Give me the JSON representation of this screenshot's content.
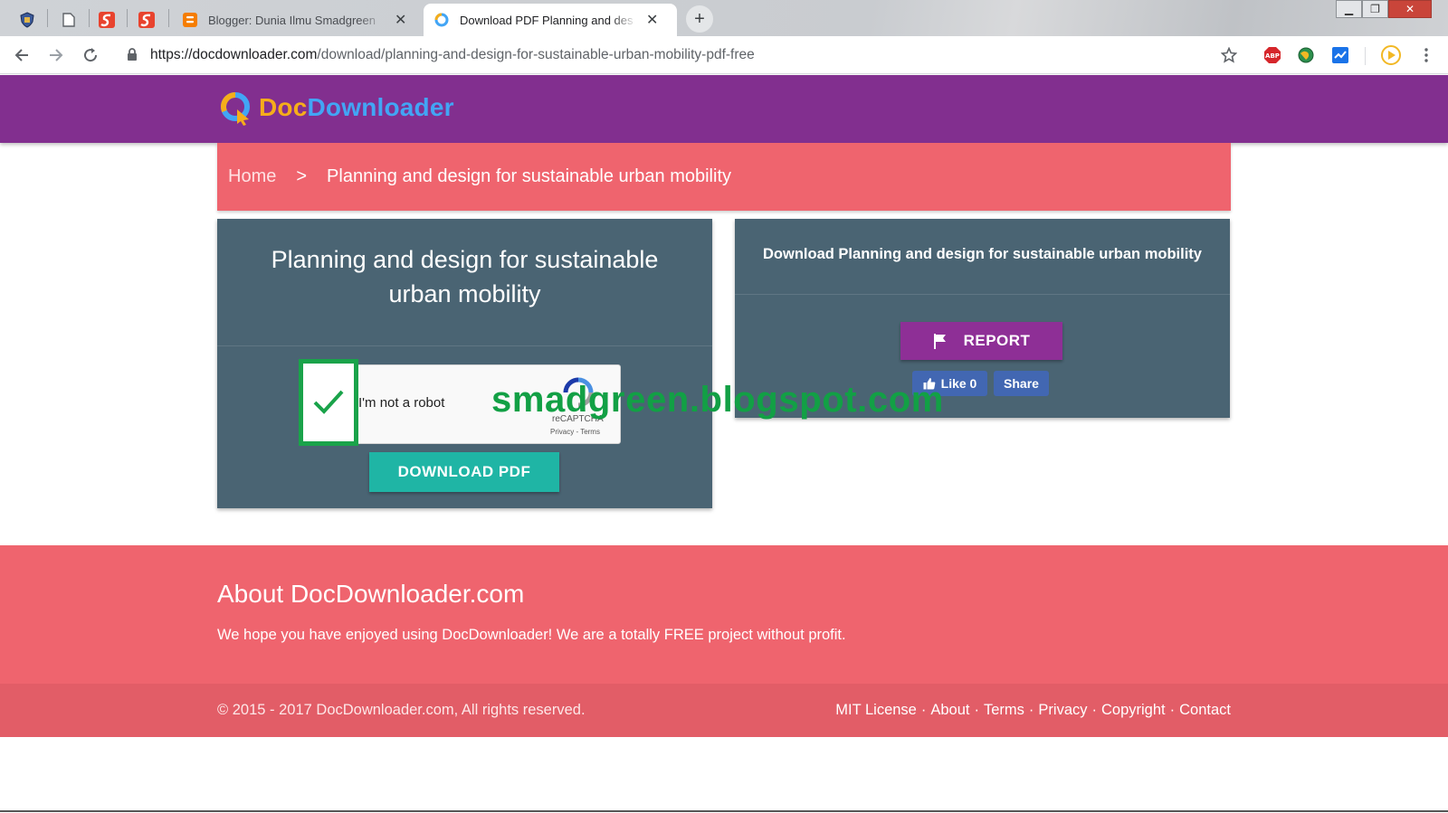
{
  "browser": {
    "tabs": [
      {
        "title": "Blogger: Dunia Ilmu Smadgreen",
        "active": false
      },
      {
        "title": "Download PDF Planning and des",
        "active": true
      }
    ],
    "new_tab_icon": "plus-icon",
    "url_host": "https://docdownloader.com",
    "url_path": "/download/planning-and-design-for-sustainable-urban-mobility-pdf-free",
    "abp_label": "ABP"
  },
  "site": {
    "logo_doc": "Doc",
    "logo_downloader": "Downloader",
    "accent_purple": "#822f8f",
    "accent_coral": "#ef646e",
    "card_color": "#4a6473",
    "button_teal": "#1fb5a5"
  },
  "breadcrumb": {
    "home": "Home",
    "separator": ">",
    "current": "Planning and design for sustainable urban mobility"
  },
  "left_card": {
    "title": "Planning and design for sustainable urban mobility",
    "captcha_label": "I'm not a robot",
    "captcha_brand": "reCAPTCHA",
    "captcha_links": "Privacy - Terms",
    "captcha_checked": true,
    "download_button": "DOWNLOAD PDF"
  },
  "watermark": "smadgreen.blogspot.com",
  "right_card": {
    "title": "Download Planning and design for sustainable urban mobility",
    "report_button": "REPORT",
    "like_button": "Like 0",
    "share_button": "Share"
  },
  "footer": {
    "about_title": "About DocDownloader.com",
    "about_text": "We hope you have enjoyed using DocDownloader! We are a totally FREE project without profit.",
    "copyright": "© 2015 - 2017 DocDownloader.com, All rights reserved.",
    "links": [
      "MIT License",
      "About",
      "Terms",
      "Privacy",
      "Copyright",
      "Contact"
    ]
  }
}
